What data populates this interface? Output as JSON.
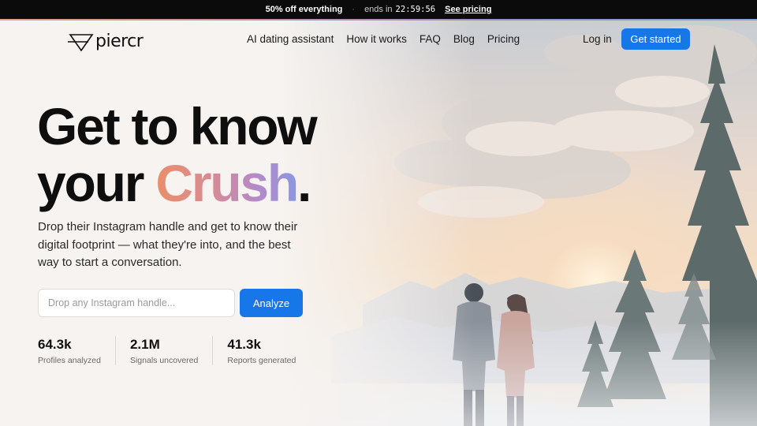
{
  "promo": {
    "offer": "50% off everything",
    "separator": "·",
    "ends_label": "ends in",
    "timer": "22:59:56",
    "link": "See pricing"
  },
  "nav": {
    "logo_text": "piercr",
    "menu": [
      {
        "label": "AI dating assistant"
      },
      {
        "label": "How it works"
      },
      {
        "label": "FAQ"
      },
      {
        "label": "Blog"
      },
      {
        "label": "Pricing"
      }
    ],
    "login": "Log in",
    "cta": "Get started"
  },
  "hero": {
    "line1": "Get to know",
    "line2_prefix": "your ",
    "highlight": "Crush",
    "period": ".",
    "subtitle": "Drop their Instagram handle and get to know their digital footprint — what they're into, and the best way to start a conversation.",
    "search_placeholder": "Drop any Instagram handle...",
    "search_value": "",
    "analyze": "Analyze"
  },
  "stats": [
    {
      "value": "64.3k",
      "label": "Profiles analyzed"
    },
    {
      "value": "2.1M",
      "label": "Signals uncovered"
    },
    {
      "value": "41.3k",
      "label": "Reports generated"
    }
  ],
  "colors": {
    "accent": "#1877e8",
    "promo_bg": "#0b0b0c",
    "page_bg": "#f6f3f0",
    "gradient": [
      "#e98f6a",
      "#d98b93",
      "#b58ac6",
      "#8d97e0"
    ]
  }
}
